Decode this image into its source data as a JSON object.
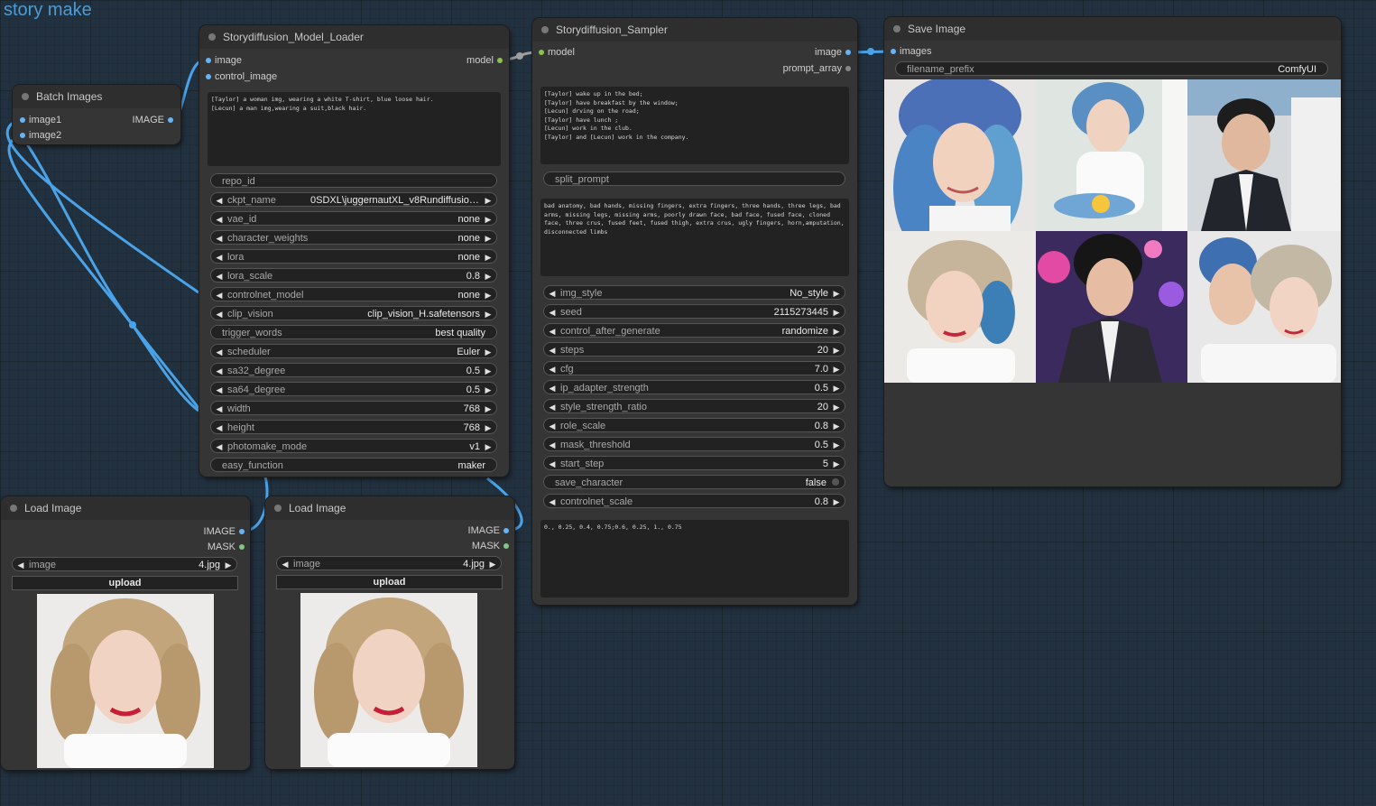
{
  "group": {
    "title": "story make"
  },
  "batch_images": {
    "title": "Batch Images",
    "inputs": [
      "image1",
      "image2"
    ],
    "output": "IMAGE"
  },
  "model_loader": {
    "title": "Storydiffusion_Model_Loader",
    "inputs": [
      "image",
      "control_image"
    ],
    "output": "model",
    "prompt_text": "[Taylor] a woman img, wearing a white T-shirt, blue loose hair.\n[Lecun] a man img,wearing a suit,black hair.",
    "widgets": [
      {
        "label": "repo_id",
        "value": "",
        "arrows": false
      },
      {
        "label": "ckpt_name",
        "value": "0SDXL\\juggernautXL_v8Rundiffusion.safet...",
        "arrows": true
      },
      {
        "label": "vae_id",
        "value": "none",
        "arrows": true
      },
      {
        "label": "character_weights",
        "value": "none",
        "arrows": true
      },
      {
        "label": "lora",
        "value": "none",
        "arrows": true
      },
      {
        "label": "lora_scale",
        "value": "0.8",
        "arrows": true
      },
      {
        "label": "controlnet_model",
        "value": "none",
        "arrows": true
      },
      {
        "label": "clip_vision",
        "value": "clip_vision_H.safetensors",
        "arrows": true
      },
      {
        "label": "trigger_words",
        "value": "best quality",
        "arrows": false
      },
      {
        "label": "scheduler",
        "value": "Euler",
        "arrows": true
      },
      {
        "label": "sa32_degree",
        "value": "0.5",
        "arrows": true
      },
      {
        "label": "sa64_degree",
        "value": "0.5",
        "arrows": true
      },
      {
        "label": "width",
        "value": "768",
        "arrows": true
      },
      {
        "label": "height",
        "value": "768",
        "arrows": true
      },
      {
        "label": "photomake_mode",
        "value": "v1",
        "arrows": true
      },
      {
        "label": "easy_function",
        "value": "maker",
        "arrows": false
      }
    ]
  },
  "sampler": {
    "title": "Storydiffusion_Sampler",
    "input": "model",
    "outputs": [
      "image",
      "prompt_array"
    ],
    "story_text": "[Taylor] wake up in the bed;\n[Taylor] have breakfast by the window;\n[Lecun] drving on the road;\n[Taylor] have lunch ;\n[Lecun] work in the club.\n[Taylor] and [Lecun] work in the company.",
    "split_prompt": "split_prompt",
    "negative_text": "bad anatomy, bad hands, missing fingers, extra fingers, three hands, three legs, bad arms, missing legs, missing arms, poorly drawn face, bad face, fused face, cloned face, three crus, fused feet, fused thigh, extra crus, ugly fingers, horn,amputation, disconnected limbs",
    "widgets": [
      {
        "label": "img_style",
        "value": "No_style",
        "arrows": true
      },
      {
        "label": "seed",
        "value": "2115273445",
        "arrows": true
      },
      {
        "label": "control_after_generate",
        "value": "randomize",
        "arrows": true
      },
      {
        "label": "steps",
        "value": "20",
        "arrows": true
      },
      {
        "label": "cfg",
        "value": "7.0",
        "arrows": true
      },
      {
        "label": "ip_adapter_strength",
        "value": "0.5",
        "arrows": true
      },
      {
        "label": "style_strength_ratio",
        "value": "20",
        "arrows": true
      },
      {
        "label": "role_scale",
        "value": "0.8",
        "arrows": true
      },
      {
        "label": "mask_threshold",
        "value": "0.5",
        "arrows": true
      },
      {
        "label": "start_step",
        "value": "5",
        "arrows": true
      },
      {
        "label": "save_character",
        "value": "false",
        "arrows": false,
        "toggle": true
      },
      {
        "label": "controlnet_scale",
        "value": "0.8",
        "arrows": true
      }
    ],
    "scale_text": "0., 0.25, 0.4, 0.75;0.6, 0.25, 1., 0.75"
  },
  "save_image": {
    "title": "Save Image",
    "input": "images",
    "filename_label": "filename_prefix",
    "filename_value": "ComfyUI"
  },
  "load_image_1": {
    "title": "Load Image",
    "outputs": [
      "IMAGE",
      "MASK"
    ],
    "image_label": "image",
    "image_value": "4.jpg",
    "upload_label": "upload"
  },
  "load_image_2": {
    "title": "Load Image",
    "outputs": [
      "IMAGE",
      "MASK"
    ],
    "image_label": "image",
    "image_value": "4.jpg",
    "upload_label": "upload"
  },
  "colors": {
    "link": "#4aa3e8",
    "image_slot": "#64b5f6",
    "mask_slot": "#81c784",
    "model_slot": "#8bc34a",
    "node_bg": "#353535",
    "canvas_bg": "#22313f"
  }
}
